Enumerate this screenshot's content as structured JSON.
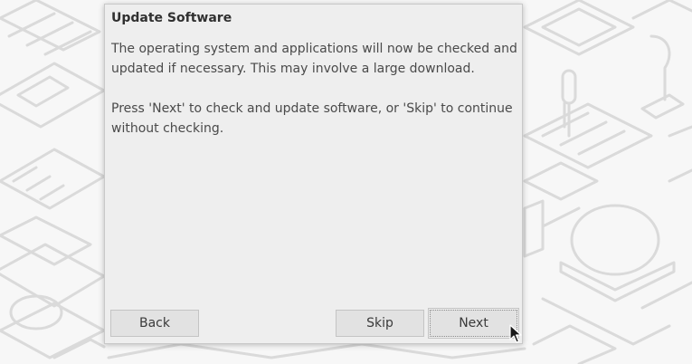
{
  "dialog": {
    "title": "Update Software",
    "paragraph1": "The operating system and applications will now be checked and\nupdated if necessary. This may involve a large download.",
    "paragraph2": "Press 'Next' to check and update software, or 'Skip' to continue\nwithout checking."
  },
  "buttons": {
    "back_label": "Back",
    "skip_label": "Skip",
    "next_label": "Next"
  },
  "colors": {
    "dialog_bg": "#eeeeee",
    "button_bg": "#e2e2e2",
    "wallpaper_line": "#dcdcdc"
  },
  "icons": {
    "cursor": "mouse-pointer-icon"
  }
}
